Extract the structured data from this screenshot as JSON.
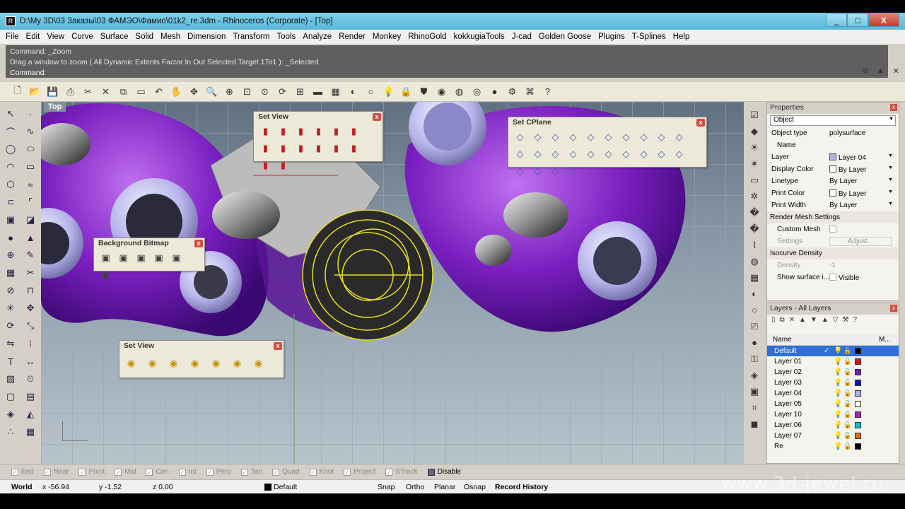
{
  "window": {
    "title": "D:\\My 3D\\03 Заказы\\03 ФАМЭО\\Фамио\\01k2_re.3dm - Rhinoceros (Corporate) - [Top]",
    "icon": "rhino-icon",
    "buttons": [
      "_",
      "□",
      "X"
    ]
  },
  "menu": [
    "File",
    "Edit",
    "View",
    "Curve",
    "Surface",
    "Solid",
    "Mesh",
    "Dimension",
    "Transform",
    "Tools",
    "Analyze",
    "Render",
    "Monkey",
    "RhinoGold",
    "kokkugiaTools",
    "J-cad",
    "Golden Goose",
    "Plugins",
    "T-Splines",
    "Help"
  ],
  "command": {
    "line1": "Command: _Zoom",
    "line2": "Drag a window to zoom ( All  Dynamic  Extents  Factor  In  Out  Selected  Target  1To1 ): _Selected",
    "prompt": "Command:"
  },
  "viewport": {
    "label": "Top"
  },
  "panels": {
    "setview1": {
      "title": "Set View"
    },
    "setcplane": {
      "title": "Set CPlane"
    },
    "bgbitmap": {
      "title": "Background Bitmap"
    },
    "setview2": {
      "title": "Set View"
    }
  },
  "properties": {
    "header": "Properties",
    "selector": "Object",
    "rows": [
      {
        "k": "Object type",
        "v": "polysurface"
      },
      {
        "k": "Name",
        "v": ""
      },
      {
        "k": "Layer",
        "v": "Layer 04"
      },
      {
        "k": "Display Color",
        "v": "By Layer"
      },
      {
        "k": "Linetype",
        "v": "By Layer"
      },
      {
        "k": "Print Color",
        "v": "By Layer"
      },
      {
        "k": "Print Width",
        "v": "By Layer"
      }
    ],
    "render_section": "Render Mesh Settings",
    "custom_mesh": "Custom Mesh",
    "settings": "Settings",
    "adjust": "Adjust...",
    "isocurve_section": "Isocurve Density",
    "density": "Density",
    "density_value": "-1",
    "show_surface": "Show surface i...",
    "visible": "Visible"
  },
  "layers": {
    "header": "Layers - All Layers",
    "col_name": "Name",
    "col_m": "M...",
    "items": [
      {
        "name": "Default",
        "color": "#000000",
        "selected": true
      },
      {
        "name": "Layer 01",
        "color": "#e01010"
      },
      {
        "name": "Layer 02",
        "color": "#7020b0"
      },
      {
        "name": "Layer 03",
        "color": "#1010d0"
      },
      {
        "name": "Layer 04",
        "color": "#b0b0e8"
      },
      {
        "name": "Layer 05",
        "color": "#ffffff"
      },
      {
        "name": "Layer 10",
        "color": "#a020c0"
      },
      {
        "name": "Layer 06",
        "color": "#10c0d0"
      },
      {
        "name": "Layer 07",
        "color": "#e07010"
      },
      {
        "name": "Re",
        "color": "#000000"
      }
    ]
  },
  "snaps": [
    {
      "label": "End",
      "on": false
    },
    {
      "label": "Near",
      "on": false
    },
    {
      "label": "Point",
      "on": false
    },
    {
      "label": "Mid",
      "on": false
    },
    {
      "label": "Cen",
      "on": false
    },
    {
      "label": "Int",
      "on": false
    },
    {
      "label": "Perp",
      "on": false
    },
    {
      "label": "Tan",
      "on": false
    },
    {
      "label": "Quad",
      "on": false
    },
    {
      "label": "Knot",
      "on": false
    },
    {
      "label": "Project",
      "on": false
    },
    {
      "label": "STrack",
      "on": false
    },
    {
      "label": "Disable",
      "on": true
    }
  ],
  "status": {
    "world": "World",
    "x": "x -56.94",
    "y": "y -1.52",
    "z": "z 0.00",
    "layer": "Default",
    "snap": "Snap",
    "ortho": "Ortho",
    "planar": "Planar",
    "osnap": "Osnap",
    "history": "Record History"
  },
  "watermark": "www.3d-jewel.ru",
  "colors": {
    "purple": "#7a1fc0",
    "lilac": "#b8b4ec",
    "gold": "#e8e020",
    "viewport_bg": "#8a9aa8"
  }
}
